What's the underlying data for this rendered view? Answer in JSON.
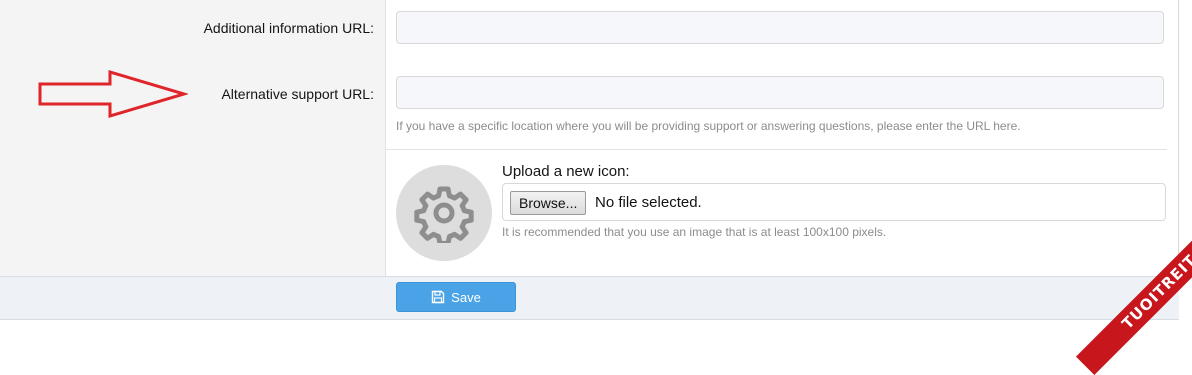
{
  "fields": {
    "additional_info": {
      "label": "Additional information URL:",
      "value": ""
    },
    "alternative_support": {
      "label": "Alternative support URL:",
      "value": "",
      "hint": "If you have a specific location where you will be providing support or answering questions, please enter the URL here."
    }
  },
  "icon_upload": {
    "label": "Upload a new icon:",
    "browse_label": "Browse...",
    "file_status": "No file selected.",
    "hint": "It is recommended that you use an image that is at least 100x100 pixels.",
    "placeholder_icon": "gear-icon"
  },
  "footer": {
    "save_label": "Save",
    "save_icon": "floppy-disk-icon"
  },
  "annotation": {
    "arrow_color": "#e0252a",
    "arrow_direction": "right"
  },
  "watermark": {
    "text": "TUOITREIT.VN",
    "color": "#c8161d"
  },
  "colors": {
    "accent": "#4aa3e6",
    "label_text": "#141414",
    "hint_text": "#8c8c8c"
  }
}
